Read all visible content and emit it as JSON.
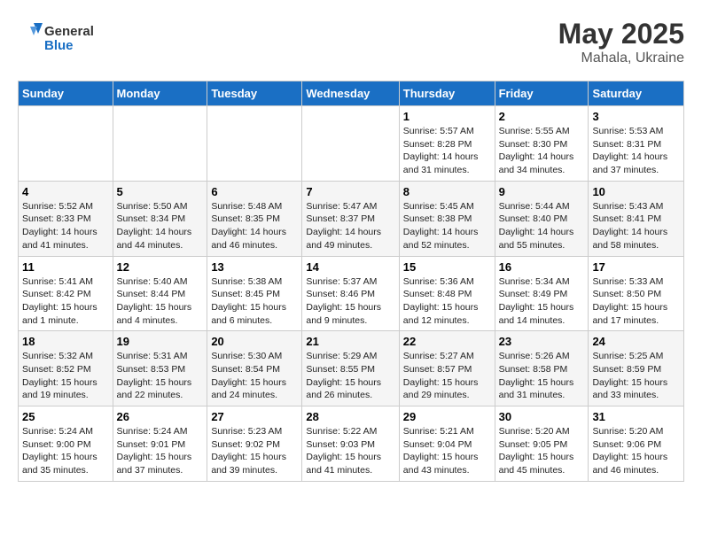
{
  "header": {
    "logo_general": "General",
    "logo_blue": "Blue",
    "month": "May 2025",
    "location": "Mahala, Ukraine"
  },
  "days_of_week": [
    "Sunday",
    "Monday",
    "Tuesday",
    "Wednesday",
    "Thursday",
    "Friday",
    "Saturday"
  ],
  "weeks": [
    [
      {
        "day": "",
        "info": ""
      },
      {
        "day": "",
        "info": ""
      },
      {
        "day": "",
        "info": ""
      },
      {
        "day": "",
        "info": ""
      },
      {
        "day": "1",
        "info": "Sunrise: 5:57 AM\nSunset: 8:28 PM\nDaylight: 14 hours\nand 31 minutes."
      },
      {
        "day": "2",
        "info": "Sunrise: 5:55 AM\nSunset: 8:30 PM\nDaylight: 14 hours\nand 34 minutes."
      },
      {
        "day": "3",
        "info": "Sunrise: 5:53 AM\nSunset: 8:31 PM\nDaylight: 14 hours\nand 37 minutes."
      }
    ],
    [
      {
        "day": "4",
        "info": "Sunrise: 5:52 AM\nSunset: 8:33 PM\nDaylight: 14 hours\nand 41 minutes."
      },
      {
        "day": "5",
        "info": "Sunrise: 5:50 AM\nSunset: 8:34 PM\nDaylight: 14 hours\nand 44 minutes."
      },
      {
        "day": "6",
        "info": "Sunrise: 5:48 AM\nSunset: 8:35 PM\nDaylight: 14 hours\nand 46 minutes."
      },
      {
        "day": "7",
        "info": "Sunrise: 5:47 AM\nSunset: 8:37 PM\nDaylight: 14 hours\nand 49 minutes."
      },
      {
        "day": "8",
        "info": "Sunrise: 5:45 AM\nSunset: 8:38 PM\nDaylight: 14 hours\nand 52 minutes."
      },
      {
        "day": "9",
        "info": "Sunrise: 5:44 AM\nSunset: 8:40 PM\nDaylight: 14 hours\nand 55 minutes."
      },
      {
        "day": "10",
        "info": "Sunrise: 5:43 AM\nSunset: 8:41 PM\nDaylight: 14 hours\nand 58 minutes."
      }
    ],
    [
      {
        "day": "11",
        "info": "Sunrise: 5:41 AM\nSunset: 8:42 PM\nDaylight: 15 hours\nand 1 minute."
      },
      {
        "day": "12",
        "info": "Sunrise: 5:40 AM\nSunset: 8:44 PM\nDaylight: 15 hours\nand 4 minutes."
      },
      {
        "day": "13",
        "info": "Sunrise: 5:38 AM\nSunset: 8:45 PM\nDaylight: 15 hours\nand 6 minutes."
      },
      {
        "day": "14",
        "info": "Sunrise: 5:37 AM\nSunset: 8:46 PM\nDaylight: 15 hours\nand 9 minutes."
      },
      {
        "day": "15",
        "info": "Sunrise: 5:36 AM\nSunset: 8:48 PM\nDaylight: 15 hours\nand 12 minutes."
      },
      {
        "day": "16",
        "info": "Sunrise: 5:34 AM\nSunset: 8:49 PM\nDaylight: 15 hours\nand 14 minutes."
      },
      {
        "day": "17",
        "info": "Sunrise: 5:33 AM\nSunset: 8:50 PM\nDaylight: 15 hours\nand 17 minutes."
      }
    ],
    [
      {
        "day": "18",
        "info": "Sunrise: 5:32 AM\nSunset: 8:52 PM\nDaylight: 15 hours\nand 19 minutes."
      },
      {
        "day": "19",
        "info": "Sunrise: 5:31 AM\nSunset: 8:53 PM\nDaylight: 15 hours\nand 22 minutes."
      },
      {
        "day": "20",
        "info": "Sunrise: 5:30 AM\nSunset: 8:54 PM\nDaylight: 15 hours\nand 24 minutes."
      },
      {
        "day": "21",
        "info": "Sunrise: 5:29 AM\nSunset: 8:55 PM\nDaylight: 15 hours\nand 26 minutes."
      },
      {
        "day": "22",
        "info": "Sunrise: 5:27 AM\nSunset: 8:57 PM\nDaylight: 15 hours\nand 29 minutes."
      },
      {
        "day": "23",
        "info": "Sunrise: 5:26 AM\nSunset: 8:58 PM\nDaylight: 15 hours\nand 31 minutes."
      },
      {
        "day": "24",
        "info": "Sunrise: 5:25 AM\nSunset: 8:59 PM\nDaylight: 15 hours\nand 33 minutes."
      }
    ],
    [
      {
        "day": "25",
        "info": "Sunrise: 5:24 AM\nSunset: 9:00 PM\nDaylight: 15 hours\nand 35 minutes."
      },
      {
        "day": "26",
        "info": "Sunrise: 5:24 AM\nSunset: 9:01 PM\nDaylight: 15 hours\nand 37 minutes."
      },
      {
        "day": "27",
        "info": "Sunrise: 5:23 AM\nSunset: 9:02 PM\nDaylight: 15 hours\nand 39 minutes."
      },
      {
        "day": "28",
        "info": "Sunrise: 5:22 AM\nSunset: 9:03 PM\nDaylight: 15 hours\nand 41 minutes."
      },
      {
        "day": "29",
        "info": "Sunrise: 5:21 AM\nSunset: 9:04 PM\nDaylight: 15 hours\nand 43 minutes."
      },
      {
        "day": "30",
        "info": "Sunrise: 5:20 AM\nSunset: 9:05 PM\nDaylight: 15 hours\nand 45 minutes."
      },
      {
        "day": "31",
        "info": "Sunrise: 5:20 AM\nSunset: 9:06 PM\nDaylight: 15 hours\nand 46 minutes."
      }
    ]
  ]
}
